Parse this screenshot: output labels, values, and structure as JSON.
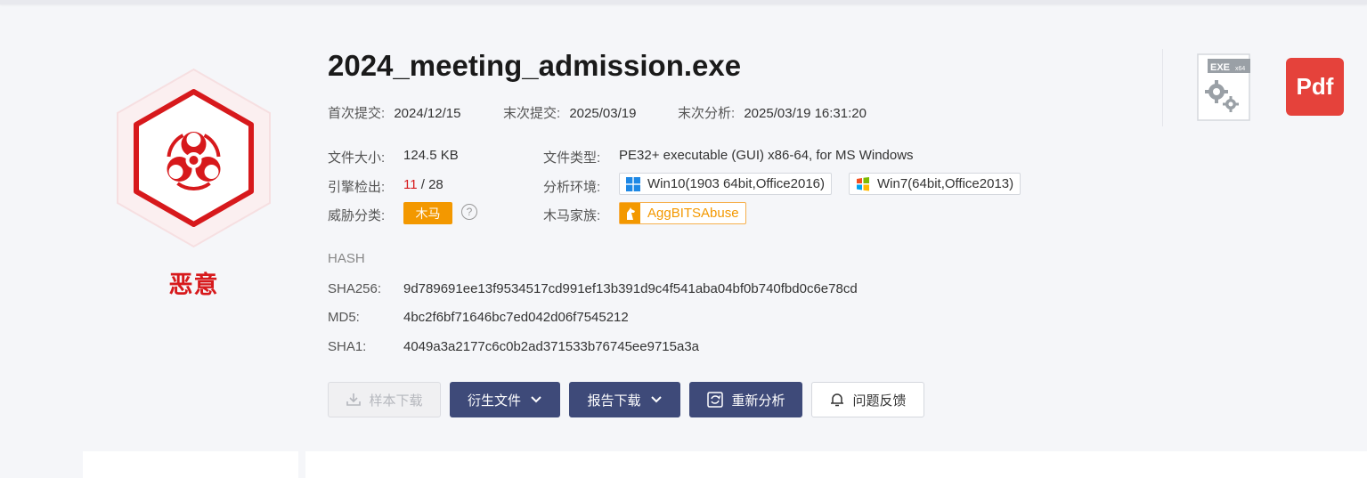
{
  "verdict": {
    "label": "恶意",
    "color": "#d7191c"
  },
  "file": {
    "name": "2024_meeting_admission.exe",
    "first_submit_label": "首次提交:",
    "first_submit": "2024/12/15",
    "last_submit_label": "末次提交:",
    "last_submit": "2025/03/19",
    "last_analysis_label": "末次分析:",
    "last_analysis": "2025/03/19 16:31:20",
    "size_label": "文件大小:",
    "size": "124.5 KB",
    "type_label": "文件类型:",
    "type": "PE32+ executable (GUI) x86-64, for MS Windows",
    "engine_label": "引擎检出:",
    "engine_detected": "11",
    "engine_sep": " / ",
    "engine_total": "28",
    "env_label": "分析环境:",
    "envs": [
      "Win10(1903 64bit,Office2016)",
      "Win7(64bit,Office2013)"
    ],
    "threat_label": "威胁分类:",
    "threat": "木马",
    "family_label": "木马家族:",
    "family": "AggBITSAbuse"
  },
  "hash": {
    "title": "HASH",
    "sha256_label": "SHA256:",
    "sha256": "9d789691ee13f9534517cd991ef13b391d9c4f541aba04bf0b740fbd0c6e78cd",
    "md5_label": "MD5:",
    "md5": "4bc2f6bf71646bc7ed042d06f7545212",
    "sha1_label": "SHA1:",
    "sha1": "4049a3a2177c6c0b2ad371533b76745ee9715a3a"
  },
  "actions": {
    "sample_download": "样本下载",
    "derived_files": "衍生文件",
    "report_download": "报告下载",
    "reanalyze": "重新分析",
    "feedback": "问题反馈"
  },
  "icons": {
    "exe_badge": "EXE",
    "exe_sub": "x64",
    "pdf": "Pdf"
  },
  "colors": {
    "malicious": "#d7191c",
    "accent_dark": "#3e4a79",
    "trojan": "#f39800"
  }
}
